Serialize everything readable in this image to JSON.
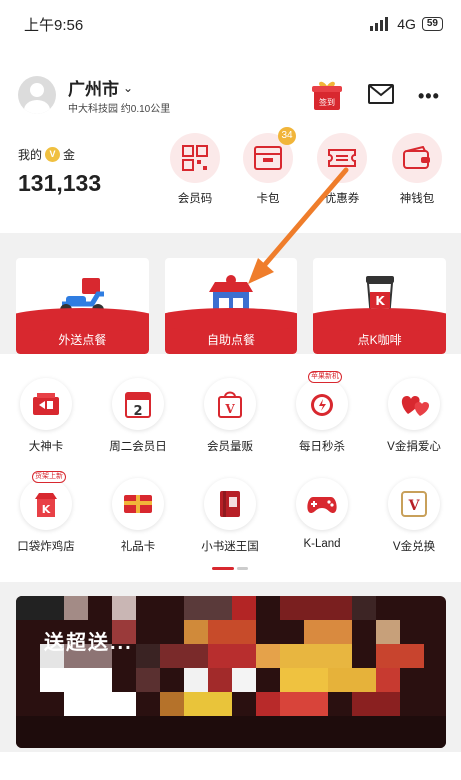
{
  "status_bar": {
    "time": "上午9:56",
    "network": "4G",
    "battery": "59"
  },
  "header": {
    "city": "广州市",
    "store": "中大科技园 约0.10公里",
    "signin_label": "签到",
    "gold_label_prefix": "我的",
    "gold_label_suffix": "金",
    "gold_coin_letter": "V",
    "gold_amount": "131,133"
  },
  "quick_actions": [
    {
      "label": "会员码",
      "icon": "qr-code-icon"
    },
    {
      "label": "卡包",
      "icon": "card-wallet-icon",
      "badge": "34"
    },
    {
      "label": "优惠券",
      "icon": "coupon-icon"
    },
    {
      "label": "神钱包",
      "icon": "wallet-icon"
    }
  ],
  "order_cards": [
    {
      "label": "外送点餐",
      "icon": "delivery-scooter-icon"
    },
    {
      "label": "自助点餐",
      "icon": "store-icon"
    },
    {
      "label": "点K咖啡",
      "icon": "coffee-cup-icon"
    }
  ],
  "services": [
    {
      "label": "大神卡",
      "icon": "god-card-icon"
    },
    {
      "label": "周二会员日",
      "icon": "calendar-icon",
      "icon_text": "2"
    },
    {
      "label": "会员量贩",
      "icon": "shopping-bag-icon",
      "icon_text": "V"
    },
    {
      "label": "每日秒杀",
      "icon": "alarm-clock-icon",
      "tag": "苹果新机"
    },
    {
      "label": "V金捐爱心",
      "icon": "hearts-icon"
    },
    {
      "label": "口袋炸鸡店",
      "icon": "chicken-shop-icon",
      "tag": "货架上新",
      "icon_text": "K"
    },
    {
      "label": "礼品卡",
      "icon": "gift-card-icon"
    },
    {
      "label": "小书迷王国",
      "icon": "book-icon"
    },
    {
      "label": "K-Land",
      "icon": "gamepad-icon"
    },
    {
      "label": "V金兑换",
      "icon": "v-gold-exchange-icon",
      "icon_text": "V"
    }
  ],
  "banner": {
    "text": "送超送... "
  },
  "colors": {
    "brand_red": "#d8282f",
    "badge_gold": "#f1b53a",
    "arrow_orange": "#ef7d2b"
  }
}
